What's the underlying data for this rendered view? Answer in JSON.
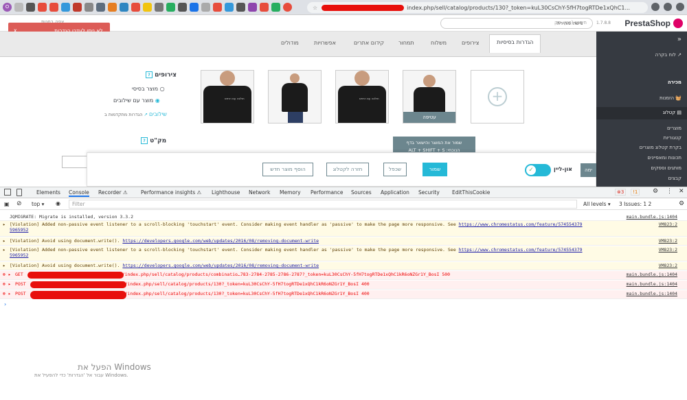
{
  "browser": {
    "url": "index.php/sell/catalog/products/130?_token=kuL30CsChY-5fH7togRTDe1xQhC1...",
    "favicon_letter": "O"
  },
  "header": {
    "error_message": "לא ניתן לעדכן הגדרות.",
    "error_close": "x",
    "search_placeholder": "חיפוש (כגון: מק",
    "quick_access": "גישה מהירה",
    "version": "1.7.8.8",
    "logo": "PrestaShop",
    "top_left_text": "צפה בחנות"
  },
  "sidebar": {
    "collapse": "»",
    "dashboard": "לוח בקרה",
    "section_sell": "מכירה",
    "orders": "הזמנות",
    "catalog": "קטלוג",
    "items": [
      "מוצרים",
      "קטגוריות",
      "בקרת קטלוג מוצרים",
      "תכונות ומאפיינים",
      "מותגים וספקים",
      "קבצים"
    ]
  },
  "tabs": [
    "הגדרות בסיסיות",
    "צירופים",
    "משלוח",
    "תמחור",
    "קידום אתרים",
    "אפשרויות",
    "מודולים"
  ],
  "product": {
    "combinations_title": "צירופים",
    "option_simple": "מוצר בסיסי",
    "option_combinations": "מוצר עם שילובים",
    "advanced_prefix": "הגדרות מתקדמות ב",
    "advanced_link": "שילובים",
    "sku_title": "מק\"ט",
    "cover_label": "עטיפה",
    "shirt_print": "חולצה עם הדפס"
  },
  "footer": {
    "online_label": "און-ליין",
    "save": "שמור",
    "preview": "שכפל",
    "back": "חזרה לקטלוג",
    "add_new": "הוסף מוצר חדש",
    "side_tab": "ימה",
    "tooltip_line1": "שמור את המוצר והישאר בדף",
    "tooltip_line2": "ALT + SHIFT + S :הנוכחי"
  },
  "devtools": {
    "tabs": [
      "Elements",
      "Console",
      "Recorder ⚠",
      "Performance insights ⚠",
      "Lighthouse",
      "Network",
      "Memory",
      "Performance",
      "Sources",
      "Application",
      "Security",
      "EditThisCookie"
    ],
    "errors_count": "3",
    "warnings_count": "1",
    "info_count": "1",
    "context": "top",
    "filter_placeholder": "Filter",
    "levels": "All levels",
    "issues": "3 Issues: 1 2"
  },
  "console": [
    {
      "type": "log",
      "text": "JQMIGRATE: Migrate is installed, version 3.3.2",
      "source": "main.bundle.js:1404"
    },
    {
      "type": "warn",
      "text": "[Violation] Added non-passive event listener to a scroll-blocking 'touchstart' event. Consider making event handler as 'passive' to make the page more responsive. See",
      "link": "https://www.chromestatus.com/feature/574554379",
      "cont": "5965952",
      "source": "VM823:2"
    },
    {
      "type": "warn",
      "text": "[Violation] Avoid using document.write().",
      "link": "https://developers.google.com/web/updates/2016/08/removing-document-write",
      "source": "VM823:2"
    },
    {
      "type": "warn",
      "text": "[Violation] Added non-passive event listener to a scroll-blocking 'touchstart' event. Consider making event handler as 'passive' to make the page more responsive. See",
      "link": "https://www.chromestatus.com/feature/574554379",
      "cont": "5965952",
      "source": "VM823:2"
    },
    {
      "type": "warn",
      "text": "[Violation] Avoid using document.write().",
      "link": "https://developers.google.com/web/updates/2016/08/removing-document-write",
      "source": "VM823:2"
    },
    {
      "type": "error",
      "method": "GET",
      "text": "/index.php/sell/catalog/products/combinatio…783-2784-2785-2786-2787?_token=kuL30CsChY-5fH7togRTDe1xQhC1kR6oNZGr1Y_BosI",
      "status": "500",
      "source": "main.bundle.js:1404"
    },
    {
      "type": "error",
      "method": "POST",
      "text": "/index.php/sell/catalog/products/130?_token=kuL30CsChY-5fH7togRTDe1xQhC1kR6oNZGr1Y_BosI",
      "status": "400",
      "source": "main.bundle.js:1404"
    },
    {
      "type": "error",
      "method": "POST",
      "text": "/index.php/sell/catalog/products/130?_token=kuL30CsChY-5fH7togRTDe1xQhC1kR6oNZGr1Y_BosI",
      "status": "400",
      "source": "main.bundle.js:1404"
    }
  ],
  "watermark": {
    "line1": "הפעל את Windows",
    "line2": "עבור אל 'הגדרות' כדי להפעיל את Windows."
  }
}
